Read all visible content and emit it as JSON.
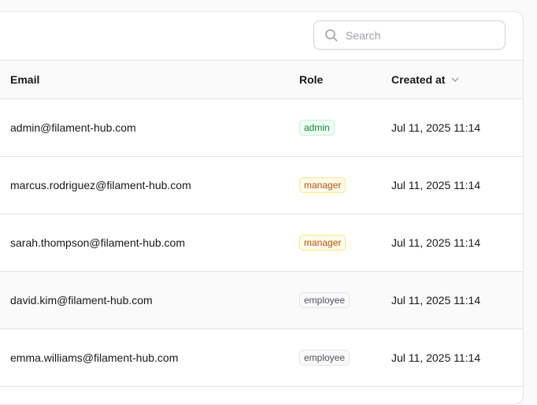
{
  "search": {
    "placeholder": "Search",
    "value": ""
  },
  "table": {
    "columns": {
      "email": "Email",
      "role": "Role",
      "created_at": "Created at"
    },
    "rows": [
      {
        "email": "admin@filament-hub.com",
        "role": "admin",
        "role_color": "success",
        "created_at": "Jul 11, 2025 11:14"
      },
      {
        "email": "marcus.rodriguez@filament-hub.com",
        "role": "manager",
        "role_color": "warning",
        "created_at": "Jul 11, 2025 11:14"
      },
      {
        "email": "sarah.thompson@filament-hub.com",
        "role": "manager",
        "role_color": "warning",
        "created_at": "Jul 11, 2025 11:14"
      },
      {
        "email": "david.kim@filament-hub.com",
        "role": "employee",
        "role_color": "gray",
        "created_at": "Jul 11, 2025 11:14"
      },
      {
        "email": "emma.williams@filament-hub.com",
        "role": "employee",
        "role_color": "gray",
        "created_at": "Jul 11, 2025 11:14"
      }
    ]
  },
  "colors": {
    "success": "#15803d",
    "warning": "#b45309",
    "gray": "#52525b",
    "border": "#e4e4e7"
  },
  "icons": {
    "search": "search-icon",
    "sort": "chevron-down-icon"
  }
}
